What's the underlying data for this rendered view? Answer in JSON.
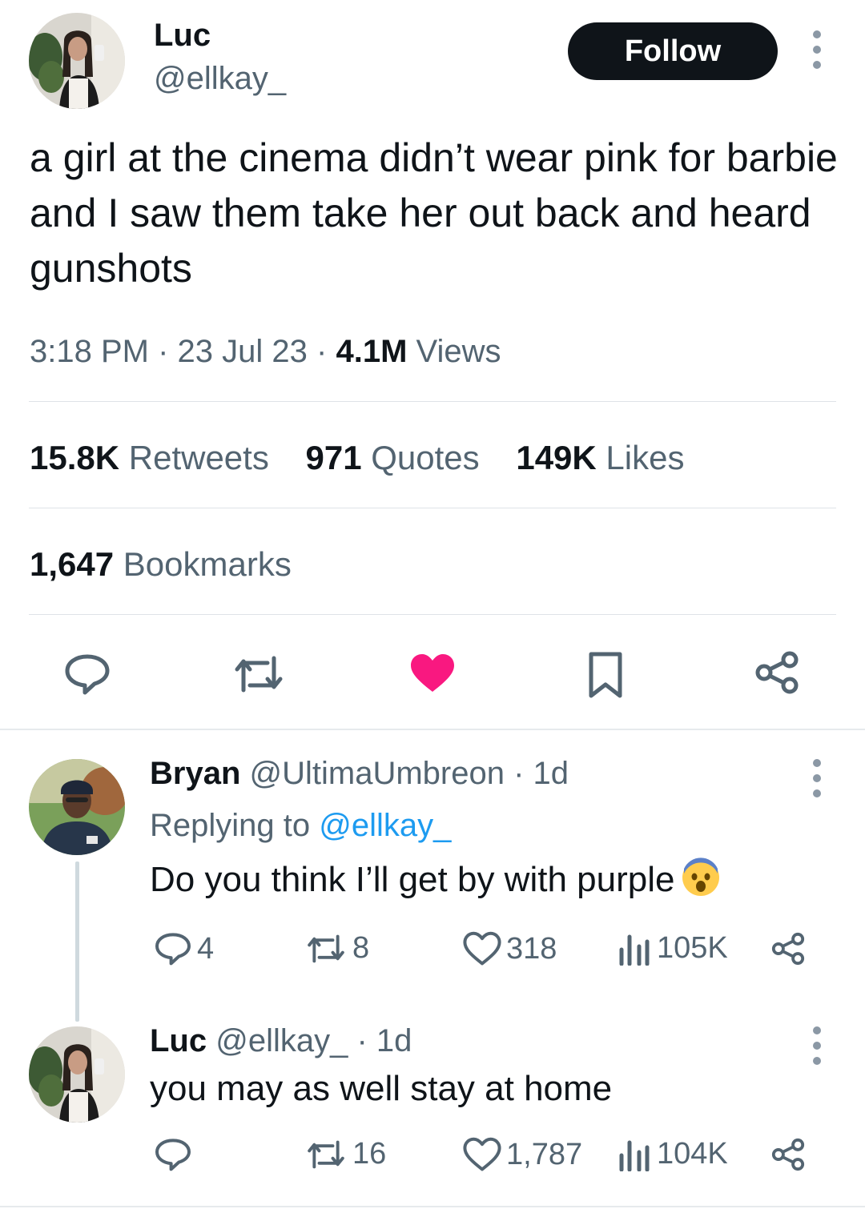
{
  "tweet": {
    "author_name": "Luc",
    "author_handle": "@ellkay_",
    "follow_label": "Follow",
    "text": "a girl at the cinema didn’t wear pink for barbie and I saw them take her out back and heard gunshots",
    "time": "3:18 PM",
    "date": "23 Jul 23",
    "views_count": "4.1M",
    "views_label": "Views",
    "separator": "·",
    "retweets_count": "15.8K",
    "retweets_label": "Retweets",
    "quotes_count": "971",
    "quotes_label": "Quotes",
    "likes_count": "149K",
    "likes_label": "Likes",
    "bookmarks_count": "1,647",
    "bookmarks_label": "Bookmarks",
    "liked": true
  },
  "replies": [
    {
      "name": "Bryan",
      "handle": "@UltimaUmbreon",
      "age": "· 1d",
      "replying_label": "Replying to",
      "replying_handle": "@ellkay_",
      "text": "Do you think I’ll get by with purple",
      "emoji": "fearful-face",
      "comments": "4",
      "retweets": "8",
      "likes": "318",
      "views": "105K"
    },
    {
      "name": "Luc",
      "handle": "@ellkay_",
      "age": "· 1d",
      "text": "you may as well stay at home",
      "comments": "",
      "retweets": "16",
      "likes": "1,787",
      "views": "104K"
    }
  ],
  "colors": {
    "text": "#0f1419",
    "muted": "#536471",
    "link": "#1d9bf0",
    "like": "#f91880",
    "divider": "#dfe3e7"
  }
}
